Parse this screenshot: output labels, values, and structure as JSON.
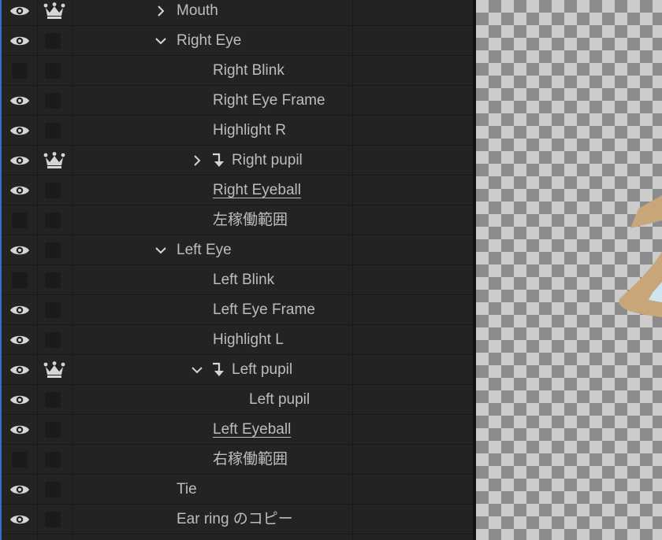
{
  "layers": [
    {
      "name": "Mouth",
      "visible": true,
      "crown": true,
      "expander": "collapsed",
      "clipped": false,
      "underline": false
    },
    {
      "name": "Right Eye",
      "visible": true,
      "crown": false,
      "expander": "expanded",
      "clipped": false,
      "underline": false
    },
    {
      "name": "Right Blink",
      "visible": false,
      "crown": false,
      "expander": "none",
      "clipped": false,
      "underline": false
    },
    {
      "name": "Right Eye Frame",
      "visible": true,
      "crown": false,
      "expander": "none",
      "clipped": false,
      "underline": false
    },
    {
      "name": "Highlight R",
      "visible": true,
      "crown": false,
      "expander": "none",
      "clipped": false,
      "underline": false
    },
    {
      "name": "Right pupil",
      "visible": true,
      "crown": true,
      "expander": "collapsed",
      "clipped": true,
      "underline": false
    },
    {
      "name": "Right Eyeball",
      "visible": true,
      "crown": false,
      "expander": "none",
      "clipped": false,
      "underline": true
    },
    {
      "name": "左稼働範囲",
      "visible": false,
      "crown": false,
      "expander": "none",
      "clipped": false,
      "underline": false
    },
    {
      "name": "Left Eye",
      "visible": true,
      "crown": false,
      "expander": "expanded",
      "clipped": false,
      "underline": false
    },
    {
      "name": "Left Blink",
      "visible": false,
      "crown": false,
      "expander": "none",
      "clipped": false,
      "underline": false
    },
    {
      "name": "Left Eye Frame",
      "visible": true,
      "crown": false,
      "expander": "none",
      "clipped": false,
      "underline": false
    },
    {
      "name": "Highlight L",
      "visible": true,
      "crown": false,
      "expander": "none",
      "clipped": false,
      "underline": false
    },
    {
      "name": "Left pupil",
      "visible": true,
      "crown": true,
      "expander": "expanded",
      "clipped": true,
      "underline": false
    },
    {
      "name": "Left pupil",
      "visible": true,
      "crown": false,
      "expander": "none",
      "clipped": false,
      "underline": false
    },
    {
      "name": "Left Eyeball",
      "visible": true,
      "crown": false,
      "expander": "none",
      "clipped": false,
      "underline": true
    },
    {
      "name": "右稼働範囲",
      "visible": false,
      "crown": false,
      "expander": "none",
      "clipped": false,
      "underline": false
    },
    {
      "name": "Tie",
      "visible": true,
      "crown": false,
      "expander": "none",
      "clipped": false,
      "underline": false
    },
    {
      "name": "Ear ring のコピー",
      "visible": true,
      "crown": false,
      "expander": "none",
      "clipped": false,
      "underline": false
    }
  ],
  "colors": {
    "panel_background": "#232323",
    "label_text": "#bdbdbd",
    "icon": "#d6d6d6",
    "selection_accent": "#2f6fd0",
    "artwork_stroke": "#c9a57a",
    "artwork_fill": "#cfe6f2"
  },
  "icons": {
    "visibility": "eye-icon",
    "crown": "crown-icon",
    "expand": "chevron-right-icon",
    "collapse": "chevron-down-icon",
    "clipping": "clipping-arrow-icon"
  }
}
